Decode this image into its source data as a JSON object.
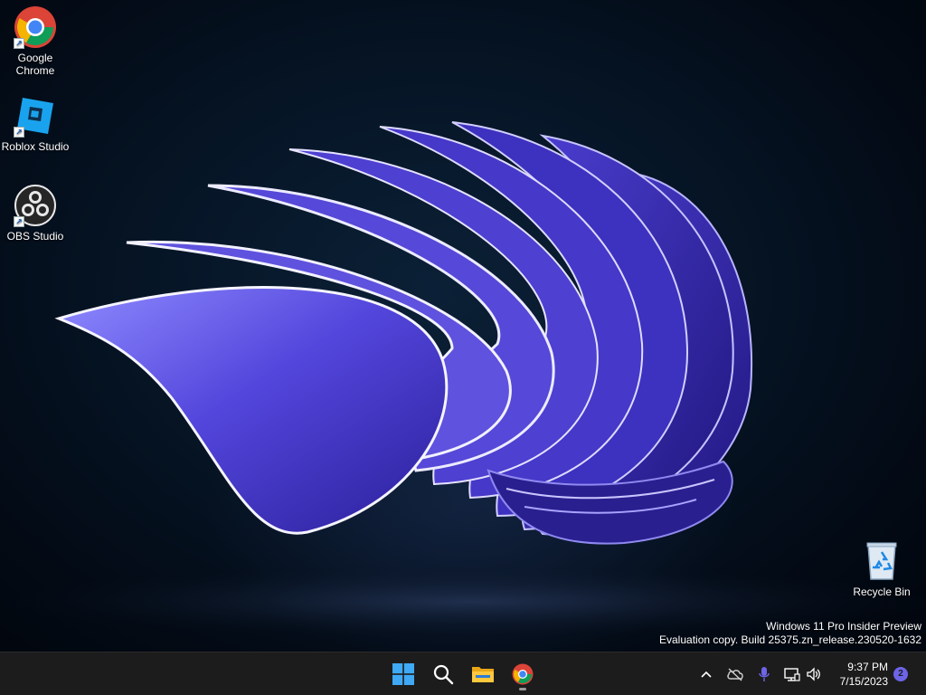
{
  "desktop": {
    "icons": [
      {
        "label": "Google\nChrome",
        "icon": "chrome-icon"
      },
      {
        "label": "Roblox Studio",
        "icon": "roblox-studio-icon"
      },
      {
        "label": "OBS Studio",
        "icon": "obs-studio-icon"
      },
      {
        "label": "Recycle Bin",
        "icon": "recycle-bin-icon"
      }
    ],
    "watermark": {
      "line1": "Windows 11 Pro Insider Preview",
      "line2": "Evaluation copy. Build 25375.zn_release.230520-1632"
    },
    "wallpaper": "Windows 11 Bloom (purple)"
  },
  "taskbar": {
    "pinned": [
      {
        "name": "start",
        "icon": "windows-start-icon"
      },
      {
        "name": "search",
        "icon": "search-icon"
      },
      {
        "name": "file-explorer",
        "icon": "file-explorer-icon"
      },
      {
        "name": "chrome",
        "icon": "chrome-icon",
        "running": true
      }
    ],
    "tray": {
      "icons": [
        "chevron-up-icon",
        "onedrive-offline-icon",
        "microphone-icon",
        "network-icon",
        "volume-icon",
        "notification-icon"
      ],
      "notification_count": "2"
    },
    "clock": {
      "time": "9:37 PM",
      "date": "7/15/2023"
    }
  },
  "colors": {
    "taskbar": "#1c1c1c",
    "accent": "#5b4fd9",
    "start_blue": "#3fa9f5"
  }
}
